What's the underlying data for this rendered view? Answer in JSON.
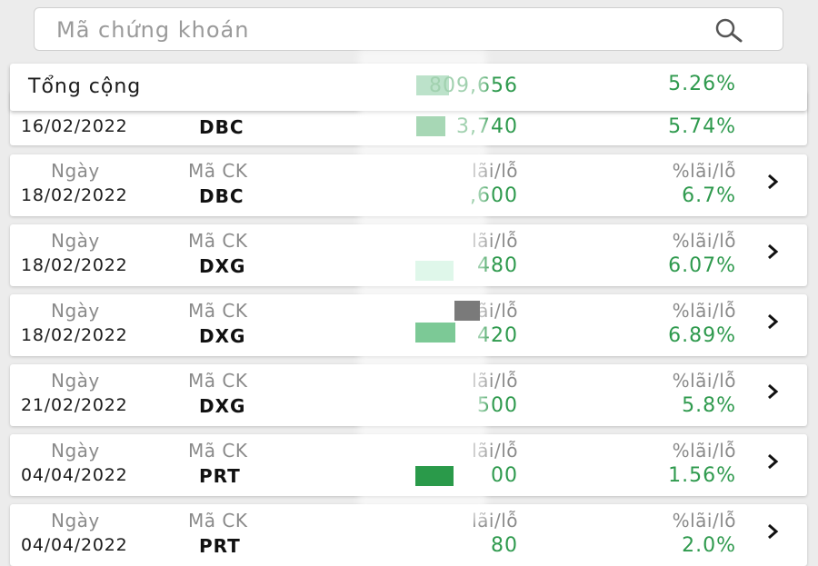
{
  "search": {
    "placeholder": "Mã chứng khoán",
    "value": ""
  },
  "labels": {
    "date": "Ngày",
    "code": "Mã CK",
    "profit": "lãi/lỗ",
    "percent": "%lãi/lỗ"
  },
  "total": {
    "label": "Tổng cộng",
    "profit": "809,656",
    "percent": "5.26%"
  },
  "partial_row": {
    "date": "16/02/2022",
    "code": "DBC",
    "profit": "3,740",
    "percent": "5.74%"
  },
  "rows": [
    {
      "date": "18/02/2022",
      "code": "DBC",
      "profit": ",600",
      "percent": "6.7%"
    },
    {
      "date": "18/02/2022",
      "code": "DXG",
      "profit": "480",
      "percent": "6.07%"
    },
    {
      "date": "18/02/2022",
      "code": "DXG",
      "profit": "420",
      "percent": "6.89%"
    },
    {
      "date": "21/02/2022",
      "code": "DXG",
      "profit": "500",
      "percent": "5.8%"
    },
    {
      "date": "04/04/2022",
      "code": "PRT",
      "profit": "00",
      "percent": "1.56%"
    },
    {
      "date": "04/04/2022",
      "code": "PRT",
      "profit": "80",
      "percent": "2.0%"
    }
  ],
  "colors": {
    "profit_green": "#2f9a4e",
    "background": "#ececec"
  }
}
